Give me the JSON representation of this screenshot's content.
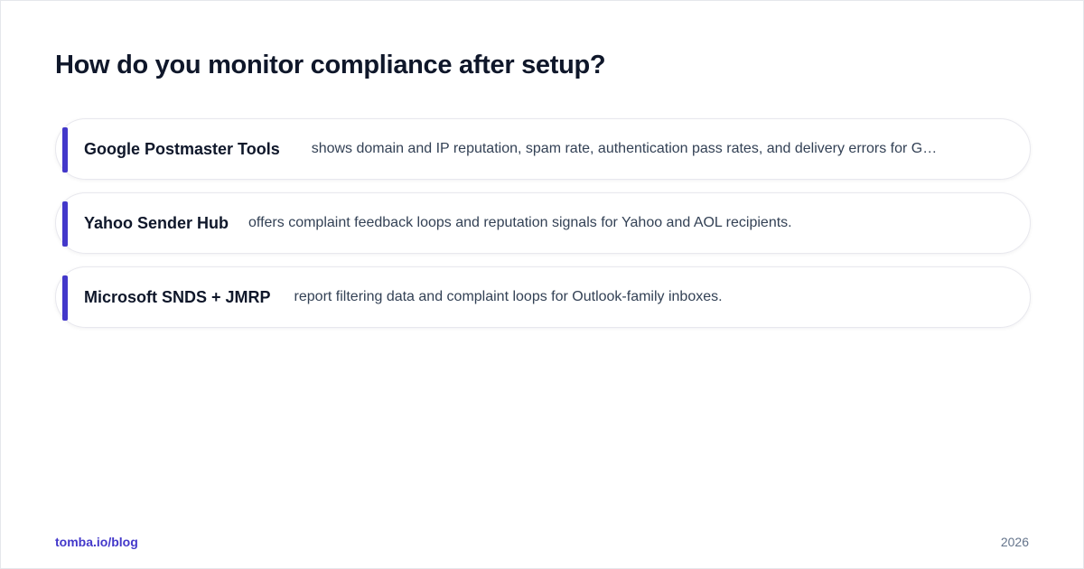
{
  "title": "How do you monitor compliance after setup?",
  "colors": {
    "accent": "#4338ca",
    "heading": "#0f172a",
    "body_text": "#334155",
    "muted": "#64748b"
  },
  "items": [
    {
      "name": "Google Postmaster Tools",
      "description": "shows domain and IP reputation, spam rate, authentication pass rates, and delivery errors for G…"
    },
    {
      "name": "Yahoo Sender Hub",
      "description": "offers complaint feedback loops and reputation signals for Yahoo and AOL recipients."
    },
    {
      "name": "Microsoft SNDS + JMRP",
      "description": "report filtering data and complaint loops for Outlook-family inboxes."
    }
  ],
  "footer": {
    "link": "tomba.io/blog",
    "year": "2026"
  }
}
